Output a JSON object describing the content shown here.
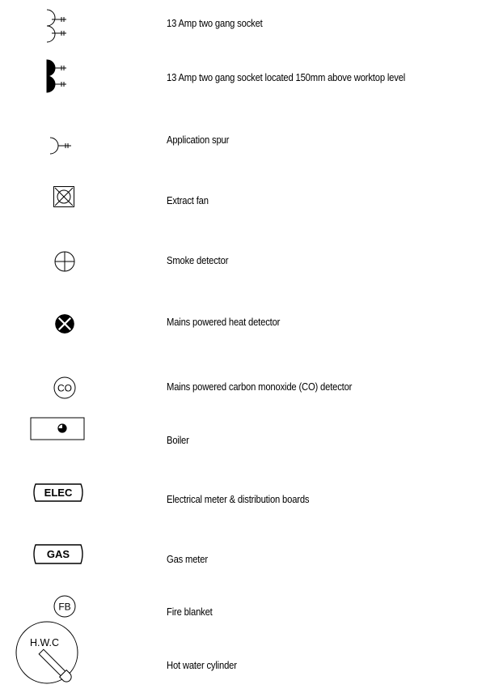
{
  "legend": {
    "items": [
      {
        "symbol": "two-gang-socket-icon",
        "label": "13 Amp two gang socket"
      },
      {
        "symbol": "two-gang-socket-worktop-icon",
        "label": "13 Amp two gang socket located 150mm above worktop level"
      },
      {
        "symbol": "application-spur-icon",
        "label": "Application spur"
      },
      {
        "symbol": "extract-fan-icon",
        "label": "Extract fan"
      },
      {
        "symbol": "smoke-detector-icon",
        "label": "Smoke detector"
      },
      {
        "symbol": "heat-detector-icon",
        "label": "Mains powered heat detector"
      },
      {
        "symbol": "co-detector-icon",
        "label": "Mains powered carbon monoxide (CO) detector",
        "code": "CO"
      },
      {
        "symbol": "boiler-icon",
        "label": "Boiler"
      },
      {
        "symbol": "electrical-meter-icon",
        "label": "Electrical meter & distribution boards",
        "code": "ELEC"
      },
      {
        "symbol": "gas-meter-icon",
        "label": "Gas meter",
        "code": "GAS"
      },
      {
        "symbol": "fire-blanket-icon",
        "label": "Fire blanket",
        "code": "FB"
      },
      {
        "symbol": "hot-water-cylinder-icon",
        "label": "Hot water cylinder",
        "code": "H.W.C"
      }
    ]
  }
}
